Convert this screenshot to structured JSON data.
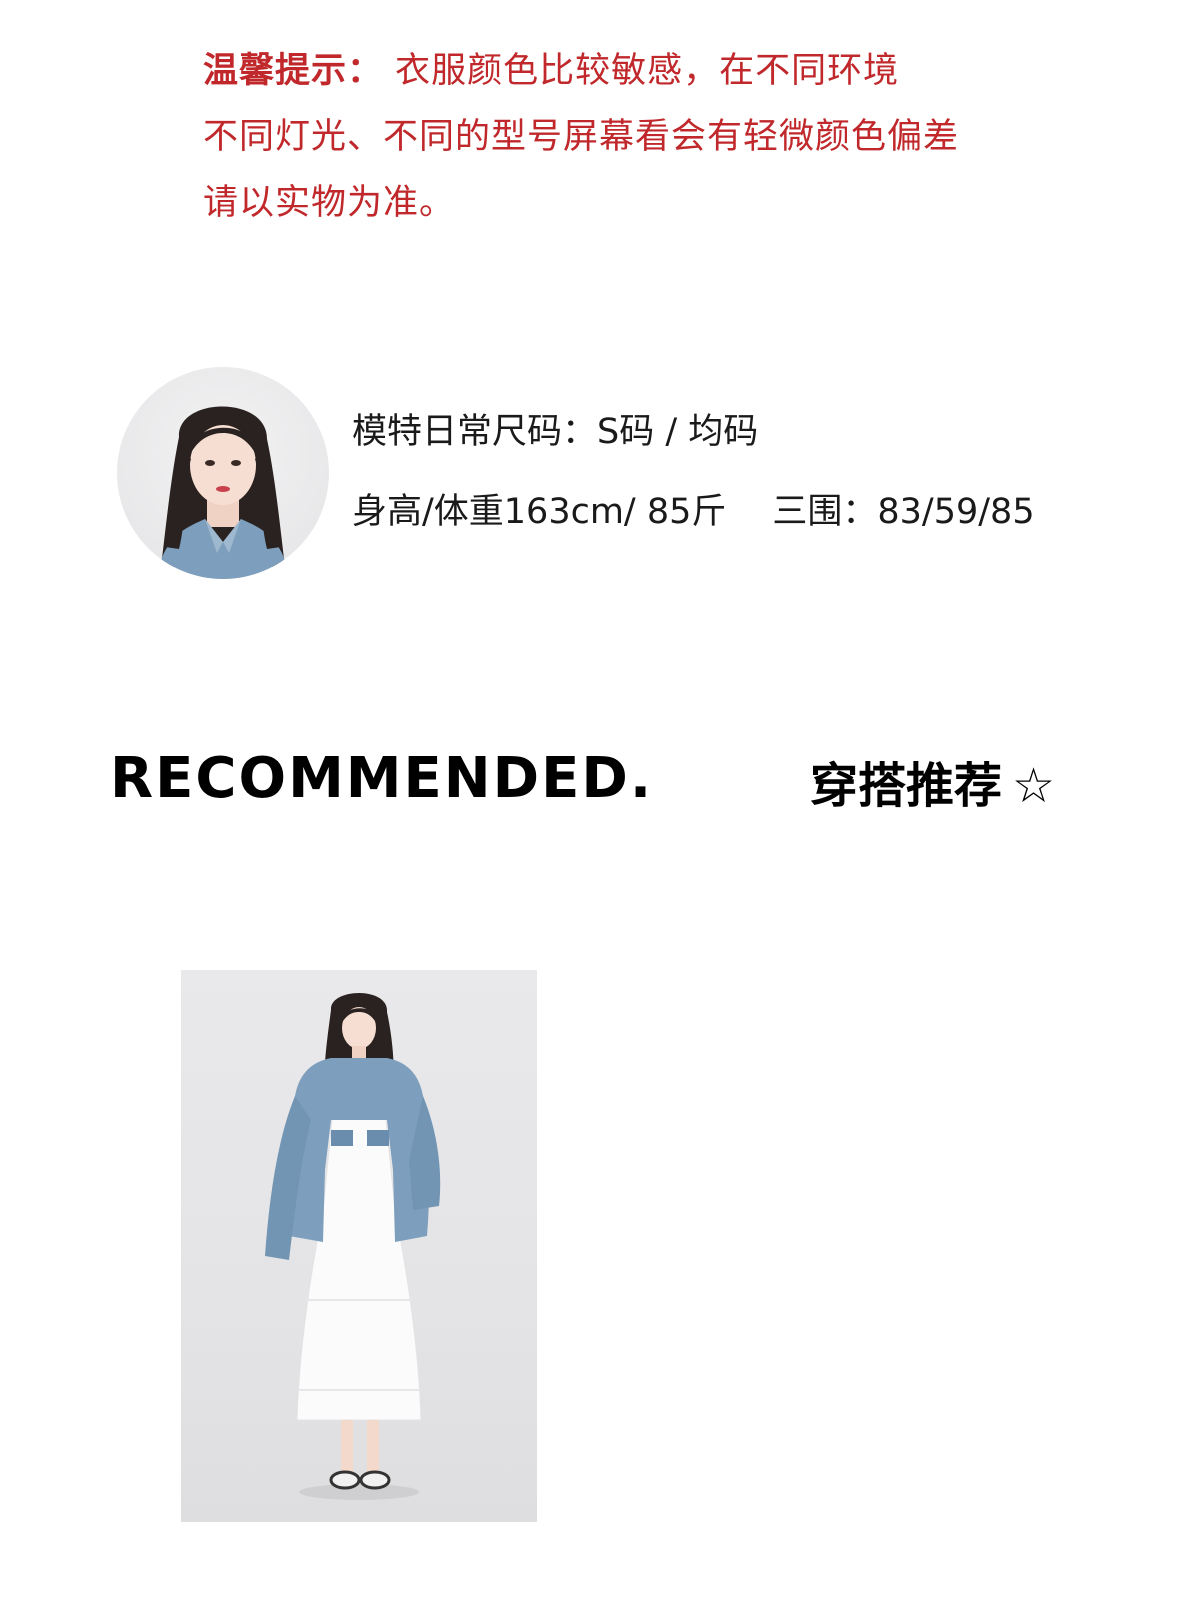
{
  "notice": {
    "label": "温馨提示：",
    "line1_rest": " 衣服颜色比较敏感，在不同环境",
    "line2": "不同灯光、不同的型号屏幕看会有轻微颜色偏差",
    "line3": "请以实物为准。"
  },
  "model": {
    "line1": "模特日常尺码：S码  /  均码",
    "line2_a": "身高/体重163cm/ 85斤",
    "line2_b": "三围：83/59/85"
  },
  "recommend": {
    "en": "RECOMMENDED.",
    "cn": "穿搭推荐",
    "star": "☆"
  },
  "colors": {
    "notice": "#c0282b",
    "text": "#1a1a1a",
    "denim": "#7d9fbd",
    "background": "#ffffff"
  }
}
